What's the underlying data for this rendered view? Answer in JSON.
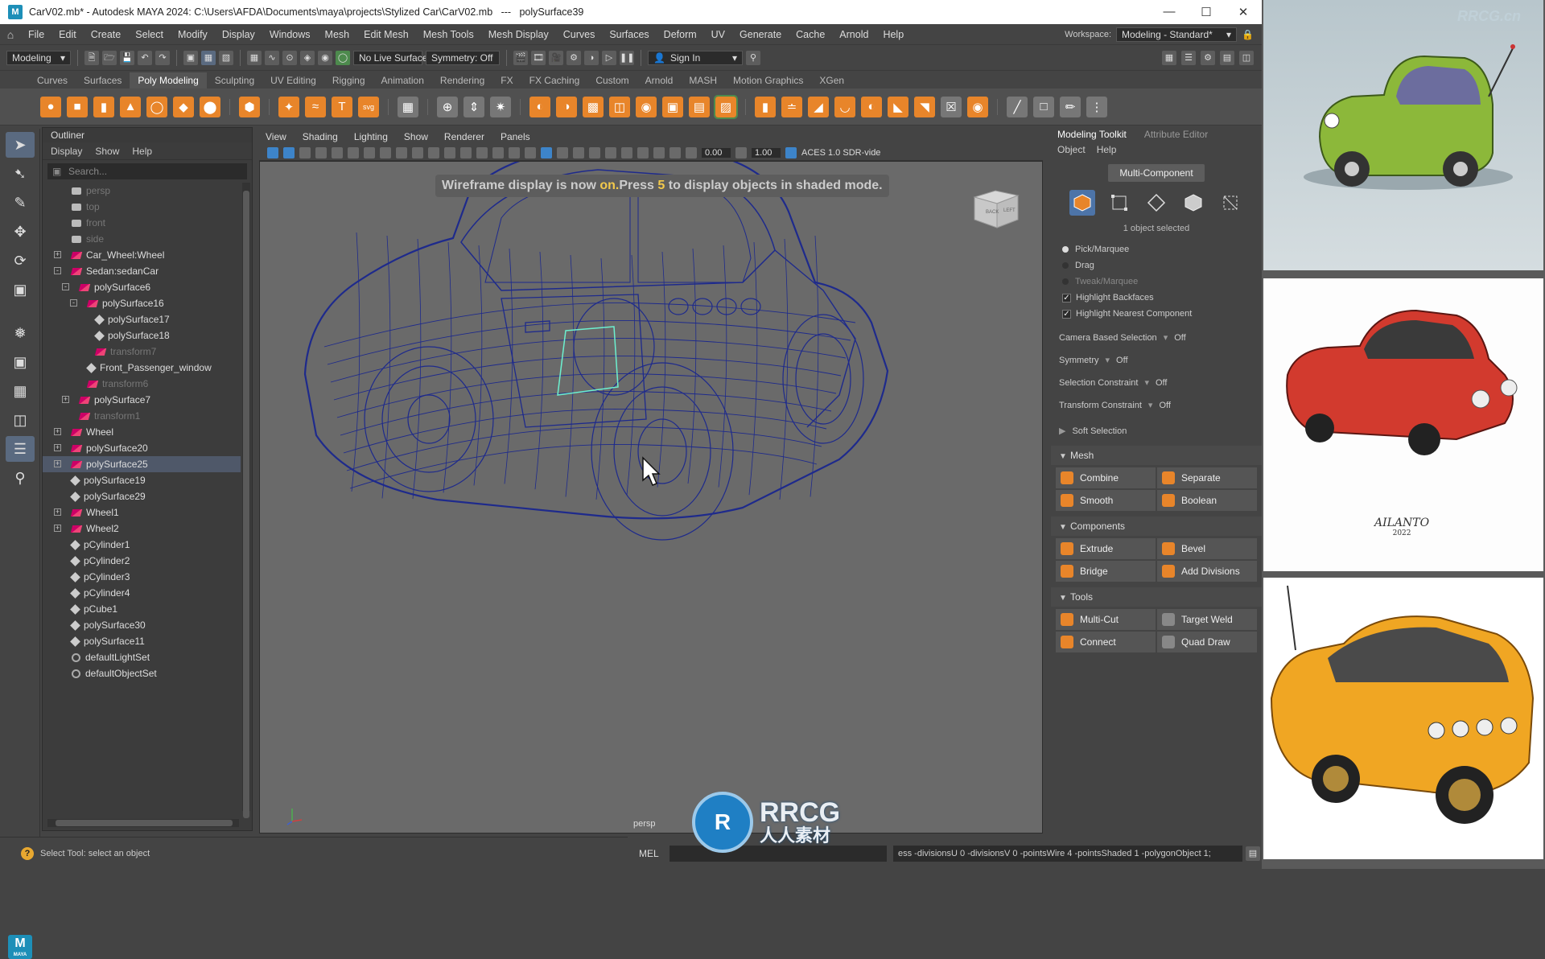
{
  "title_bar": {
    "title": "CarV02.mb* - Autodesk MAYA 2024: C:\\Users\\AFDA\\Documents\\maya\\projects\\Stylized Car\\CarV02.mb   ---   polySurface39",
    "logo": "M"
  },
  "menu_bar": {
    "items": [
      "File",
      "Edit",
      "Create",
      "Select",
      "Modify",
      "Display",
      "Windows",
      "Mesh",
      "Edit Mesh",
      "Mesh Tools",
      "Mesh Display",
      "Curves",
      "Surfaces",
      "Deform",
      "UV",
      "Generate",
      "Cache",
      "Arnold",
      "Help"
    ],
    "workspace_label": "Workspace:",
    "workspace_value": "Modeling - Standard*"
  },
  "status_line": {
    "menu_set": "Modeling",
    "live_surface": "No Live Surface",
    "symmetry": "Symmetry: Off",
    "sign_in": "Sign In"
  },
  "shelf": {
    "tabs": [
      "Curves",
      "Surfaces",
      "Poly Modeling",
      "Sculpting",
      "UV Editing",
      "Rigging",
      "Animation",
      "Rendering",
      "FX",
      "FX Caching",
      "Custom",
      "Arnold",
      "MASH",
      "Motion Graphics",
      "XGen"
    ],
    "active_tab": "Poly Modeling"
  },
  "outliner": {
    "title": "Outliner",
    "menus": [
      "Display",
      "Show",
      "Help"
    ],
    "search_placeholder": "Search...",
    "rows": [
      {
        "label": "persp",
        "depth": 0,
        "icon": "camera",
        "dim": true,
        "exp": ""
      },
      {
        "label": "top",
        "depth": 0,
        "icon": "camera",
        "dim": true,
        "exp": ""
      },
      {
        "label": "front",
        "depth": 0,
        "icon": "camera",
        "dim": true,
        "exp": ""
      },
      {
        "label": "side",
        "depth": 0,
        "icon": "camera",
        "dim": true,
        "exp": ""
      },
      {
        "label": "Car_Wheel:Wheel",
        "depth": 0,
        "icon": "mesh",
        "dim": false,
        "exp": "+"
      },
      {
        "label": "Sedan:sedanCar",
        "depth": 0,
        "icon": "mesh",
        "dim": false,
        "exp": "-"
      },
      {
        "label": "polySurface6",
        "depth": 1,
        "icon": "mesh",
        "dim": false,
        "exp": "-"
      },
      {
        "label": "polySurface16",
        "depth": 2,
        "icon": "mesh",
        "dim": false,
        "exp": "-"
      },
      {
        "label": "polySurface17",
        "depth": 3,
        "icon": "node",
        "dim": false,
        "exp": ""
      },
      {
        "label": "polySurface18",
        "depth": 3,
        "icon": "node",
        "dim": false,
        "exp": ""
      },
      {
        "label": "transform7",
        "depth": 3,
        "icon": "mesh",
        "dim": true,
        "exp": ""
      },
      {
        "label": "Front_Passenger_window",
        "depth": 2,
        "icon": "node",
        "dim": false,
        "exp": ""
      },
      {
        "label": "transform6",
        "depth": 2,
        "icon": "mesh",
        "dim": true,
        "exp": ""
      },
      {
        "label": "polySurface7",
        "depth": 1,
        "icon": "mesh",
        "dim": false,
        "exp": "+"
      },
      {
        "label": "transform1",
        "depth": 1,
        "icon": "mesh",
        "dim": true,
        "exp": ""
      },
      {
        "label": "Wheel",
        "depth": 0,
        "icon": "mesh",
        "dim": false,
        "exp": "+"
      },
      {
        "label": "polySurface20",
        "depth": 0,
        "icon": "mesh",
        "dim": false,
        "exp": "+"
      },
      {
        "label": "polySurface25",
        "depth": 0,
        "icon": "mesh",
        "dim": false,
        "exp": "+",
        "selected": true
      },
      {
        "label": "polySurface19",
        "depth": 0,
        "icon": "node",
        "dim": false,
        "exp": ""
      },
      {
        "label": "polySurface29",
        "depth": 0,
        "icon": "node",
        "dim": false,
        "exp": ""
      },
      {
        "label": "Wheel1",
        "depth": 0,
        "icon": "mesh",
        "dim": false,
        "exp": "+"
      },
      {
        "label": "Wheel2",
        "depth": 0,
        "icon": "mesh",
        "dim": false,
        "exp": "+"
      },
      {
        "label": "pCylinder1",
        "depth": 0,
        "icon": "node",
        "dim": false,
        "exp": ""
      },
      {
        "label": "pCylinder2",
        "depth": 0,
        "icon": "node",
        "dim": false,
        "exp": ""
      },
      {
        "label": "pCylinder3",
        "depth": 0,
        "icon": "node",
        "dim": false,
        "exp": ""
      },
      {
        "label": "pCylinder4",
        "depth": 0,
        "icon": "node",
        "dim": false,
        "exp": ""
      },
      {
        "label": "pCube1",
        "depth": 0,
        "icon": "node",
        "dim": false,
        "exp": ""
      },
      {
        "label": "polySurface30",
        "depth": 0,
        "icon": "node",
        "dim": false,
        "exp": ""
      },
      {
        "label": "polySurface11",
        "depth": 0,
        "icon": "node",
        "dim": false,
        "exp": ""
      },
      {
        "label": "defaultLightSet",
        "depth": 0,
        "icon": "set",
        "dim": false,
        "exp": ""
      },
      {
        "label": "defaultObjectSet",
        "depth": 0,
        "icon": "set",
        "dim": false,
        "exp": ""
      }
    ]
  },
  "viewport": {
    "menus": [
      "View",
      "Shading",
      "Lighting",
      "Show",
      "Renderer",
      "Panels"
    ],
    "field_a": "0.00",
    "field_b": "1.00",
    "color_space": "ACES 1.0 SDR-vide",
    "message_pre": "Wireframe display is now ",
    "message_on": "on.",
    "message_mid": "Press ",
    "message_key": "5",
    "message_post": " to display objects in shaded mode.",
    "camera": "persp",
    "cube_back": "BACK",
    "cube_left": "LEFT",
    "wire_color": "#1e2a8c"
  },
  "toolkit": {
    "tabs": [
      "Modeling Toolkit",
      "Attribute Editor"
    ],
    "submenus": [
      "Object",
      "Help"
    ],
    "multi_component": "Multi-Component",
    "objects_selected": "1 object selected",
    "radios": [
      {
        "label": "Pick/Marquee",
        "on": true,
        "dim": false
      },
      {
        "label": "Drag",
        "on": false,
        "dim": false
      },
      {
        "label": "Tweak/Marquee",
        "on": false,
        "dim": true
      }
    ],
    "checks": [
      "Highlight Backfaces",
      "Highlight Nearest Component"
    ],
    "options": [
      {
        "label": "Camera Based Selection",
        "value": "Off"
      },
      {
        "label": "Symmetry",
        "value": "Off"
      },
      {
        "label": "Selection Constraint",
        "value": "Off"
      },
      {
        "label": "Transform Constraint",
        "value": "Off"
      }
    ],
    "soft_selection": "Soft Selection",
    "mesh_section": "Mesh",
    "mesh_buttons": [
      "Combine",
      "Separate",
      "Smooth",
      "Boolean"
    ],
    "components_section": "Components",
    "component_buttons": [
      "Extrude",
      "Bevel",
      "Bridge",
      "Add Divisions"
    ],
    "tools_section": "Tools",
    "tool_buttons": [
      "Multi-Cut",
      "Target Weld",
      "Connect",
      "Quad Draw"
    ]
  },
  "bottom": {
    "help": "Select Tool: select an object",
    "mel": "MEL",
    "result": "ess -divisionsU 0 -divisionsV 0 -pointsWire 4 -pointsShaded 1 -polygonObject 1;"
  },
  "references": {
    "corner_watermark": "RRCG.cn",
    "signature": "AILANTO",
    "signature_year": "2022",
    "car1_color": "#8cb83a",
    "car2_color": "#d23a2e",
    "car3_color": "#f0a623"
  },
  "watermark": {
    "logo": "R",
    "line1": "RRCG",
    "line2": "人人素材"
  }
}
